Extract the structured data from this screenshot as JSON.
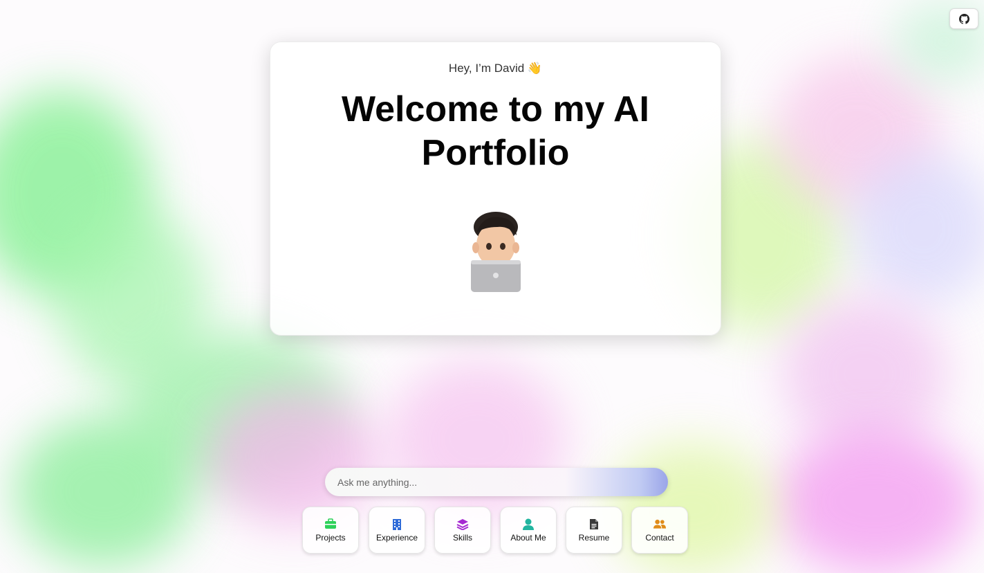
{
  "header": {
    "github_icon": "github-icon"
  },
  "hero": {
    "greeting": "Hey, I’m David 👋",
    "headline": "Welcome to my AI Portfolio",
    "avatar": "memoji-with-laptop"
  },
  "chat": {
    "placeholder": "Ask me anything..."
  },
  "nav": {
    "buttons": [
      {
        "label": "Projects",
        "icon": "briefcase-icon",
        "color": "#2ed15a"
      },
      {
        "label": "Experience",
        "icon": "building-icon",
        "color": "#2f6bd8"
      },
      {
        "label": "Skills",
        "icon": "layers-icon",
        "color": "#a52ad1"
      },
      {
        "label": "About Me",
        "icon": "user-icon",
        "color": "#22b5a0"
      },
      {
        "label": "Resume",
        "icon": "document-icon",
        "color": "#3b3b3b"
      },
      {
        "label": "Contact",
        "icon": "users-icon",
        "color": "#e08c1a"
      }
    ]
  },
  "colors": {
    "accent": "#9aa3f0"
  }
}
